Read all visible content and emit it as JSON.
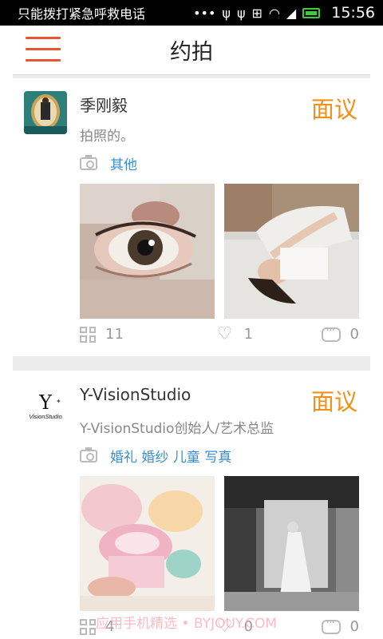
{
  "status_bar": {
    "carrier": "只能拨打紧急呼救电话",
    "time": "15:56"
  },
  "app_bar": {
    "title": "约拍"
  },
  "cards": [
    {
      "name": "季刚毅",
      "price": "面议",
      "desc": "拍照的。",
      "categories": "其他",
      "stats": {
        "photos": "11",
        "likes": "1",
        "comments": "0"
      }
    },
    {
      "name": "Y-VisionStudio",
      "price": "面议",
      "desc": "Y-VisionStudio创始人/艺术总监",
      "categories": "婚礼 婚纱 儿童 写真",
      "logo_text": "Y VisionStudio",
      "stats": {
        "photos": "4",
        "likes": "0",
        "comments": "0"
      }
    }
  ],
  "watermark": "应用手机精选 • BYJOUY.COM",
  "colors": {
    "accent": "#e85533",
    "price": "#f39019",
    "link": "#3b8fd3"
  }
}
